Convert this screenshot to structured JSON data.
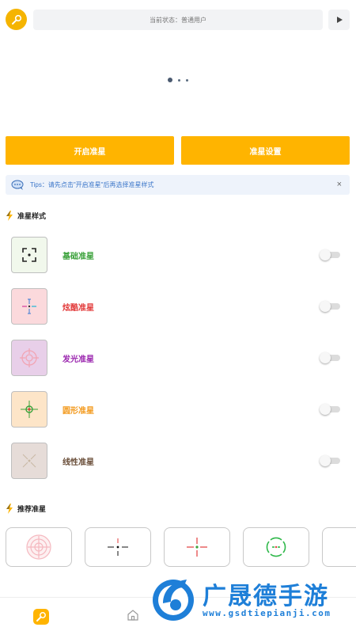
{
  "header": {
    "status_text": "当前状态：普通用户",
    "logo_icon": "wrench-icon",
    "play_icon": "play-icon"
  },
  "carousel": {
    "page_count": 3,
    "active_index": 0
  },
  "actions": {
    "start_label": "开启准星",
    "settings_label": "准星设置",
    "accent_color": "#ffb400"
  },
  "tips": {
    "text": "Tips：请先点击\"开启准星\"后再选择准星样式",
    "close_label": "×"
  },
  "styles_section": {
    "title": "准星样式",
    "items": [
      {
        "label": "基础准星",
        "color": "#3aa13a",
        "thumb_bg": "#f1f8ec",
        "enabled": false,
        "icon": "basic-crosshair-icon"
      },
      {
        "label": "炫酷准星",
        "color": "#e23b3b",
        "thumb_bg": "#fbd9dc",
        "enabled": false,
        "icon": "cool-crosshair-icon"
      },
      {
        "label": "发光准星",
        "color": "#9b27af",
        "thumb_bg": "#e8cfe9",
        "enabled": false,
        "icon": "glow-crosshair-icon"
      },
      {
        "label": "圆形准星",
        "color": "#f39a1e",
        "thumb_bg": "#fde5c8",
        "enabled": false,
        "icon": "circle-crosshair-icon"
      },
      {
        "label": "线性准星",
        "color": "#6b4f3a",
        "thumb_bg": "#e6dcd8",
        "enabled": false,
        "icon": "linear-crosshair-icon"
      }
    ]
  },
  "recommend_section": {
    "title": "推荐准星",
    "items": [
      {
        "icon": "pink-ring-crosshair-icon"
      },
      {
        "icon": "black-cross-crosshair-icon"
      },
      {
        "icon": "red-cross-crosshair-icon"
      },
      {
        "icon": "green-circle-crosshair-icon"
      },
      {
        "icon": "blue-dot-crosshair-icon"
      }
    ]
  },
  "tabbar": {
    "tabs": [
      {
        "icon": "wrench-tab-icon",
        "active": true
      },
      {
        "icon": "home-icon",
        "active": false
      }
    ]
  },
  "watermark": {
    "title": "广晟德手游",
    "url": "www.gsdtiepianji.com"
  }
}
